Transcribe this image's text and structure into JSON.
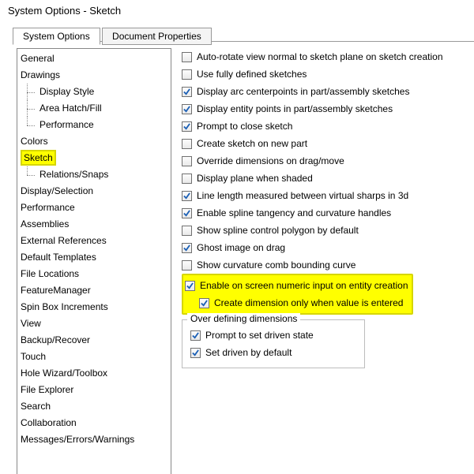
{
  "window_title": "System Options - Sketch",
  "tabs": {
    "active": "System Options",
    "inactive": "Document Properties"
  },
  "highlight_color": "#ffff00",
  "tree": [
    {
      "label": "General",
      "type": "root"
    },
    {
      "label": "Drawings",
      "type": "root"
    },
    {
      "label": "Display Style",
      "type": "child"
    },
    {
      "label": "Area Hatch/Fill",
      "type": "child"
    },
    {
      "label": "Performance",
      "type": "child",
      "last": true
    },
    {
      "label": "Colors",
      "type": "root"
    },
    {
      "label": "Sketch",
      "type": "root",
      "highlight": true
    },
    {
      "label": "Relations/Snaps",
      "type": "child",
      "last": true
    },
    {
      "label": "Display/Selection",
      "type": "root"
    },
    {
      "label": "Performance",
      "type": "root"
    },
    {
      "label": "Assemblies",
      "type": "root"
    },
    {
      "label": "External References",
      "type": "root"
    },
    {
      "label": "Default Templates",
      "type": "root"
    },
    {
      "label": "File Locations",
      "type": "root"
    },
    {
      "label": "FeatureManager",
      "type": "root"
    },
    {
      "label": "Spin Box Increments",
      "type": "root"
    },
    {
      "label": "View",
      "type": "root"
    },
    {
      "label": "Backup/Recover",
      "type": "root"
    },
    {
      "label": "Touch",
      "type": "root"
    },
    {
      "label": "Hole Wizard/Toolbox",
      "type": "root"
    },
    {
      "label": "File Explorer",
      "type": "root"
    },
    {
      "label": "Search",
      "type": "root"
    },
    {
      "label": "Collaboration",
      "type": "root"
    },
    {
      "label": "Messages/Errors/Warnings",
      "type": "root"
    }
  ],
  "options": [
    {
      "key": "auto_rotate",
      "checked": false,
      "label": "Auto-rotate view normal to sketch plane on sketch creation"
    },
    {
      "key": "fully_defined",
      "checked": false,
      "label": "Use fully defined sketches"
    },
    {
      "key": "arc_centerpoints",
      "checked": true,
      "label": "Display arc centerpoints in part/assembly sketches"
    },
    {
      "key": "entity_points",
      "checked": true,
      "label": "Display entity points in part/assembly sketches"
    },
    {
      "key": "prompt_close",
      "checked": true,
      "label": "Prompt to close sketch"
    },
    {
      "key": "create_new_part",
      "checked": false,
      "label": "Create sketch on new part"
    },
    {
      "key": "override_dims",
      "checked": false,
      "label": "Override dimensions on drag/move"
    },
    {
      "key": "plane_shaded",
      "checked": false,
      "label": "Display plane when shaded"
    },
    {
      "key": "line_length_vs",
      "checked": true,
      "label": "Line length measured between virtual sharps in 3d"
    },
    {
      "key": "spline_tangency",
      "checked": true,
      "label": "Enable spline tangency and curvature handles"
    },
    {
      "key": "spline_polygon",
      "checked": false,
      "label": "Show spline control polygon by default"
    },
    {
      "key": "ghost_drag",
      "checked": true,
      "label": "Ghost image on drag"
    },
    {
      "key": "curv_comb",
      "checked": false,
      "label": "Show curvature comb bounding curve"
    }
  ],
  "highlighted_options": [
    {
      "key": "numeric_input",
      "checked": true,
      "indent": 0,
      "label": "Enable on screen numeric input on entity creation"
    },
    {
      "key": "dim_on_value",
      "checked": true,
      "indent": 1,
      "label": "Create dimension only when value is entered"
    }
  ],
  "over_defining": {
    "legend": "Over defining dimensions",
    "items": [
      {
        "key": "prompt_driven",
        "checked": true,
        "label": "Prompt to set driven state"
      },
      {
        "key": "driven_default",
        "checked": true,
        "label": "Set driven by default"
      }
    ]
  }
}
